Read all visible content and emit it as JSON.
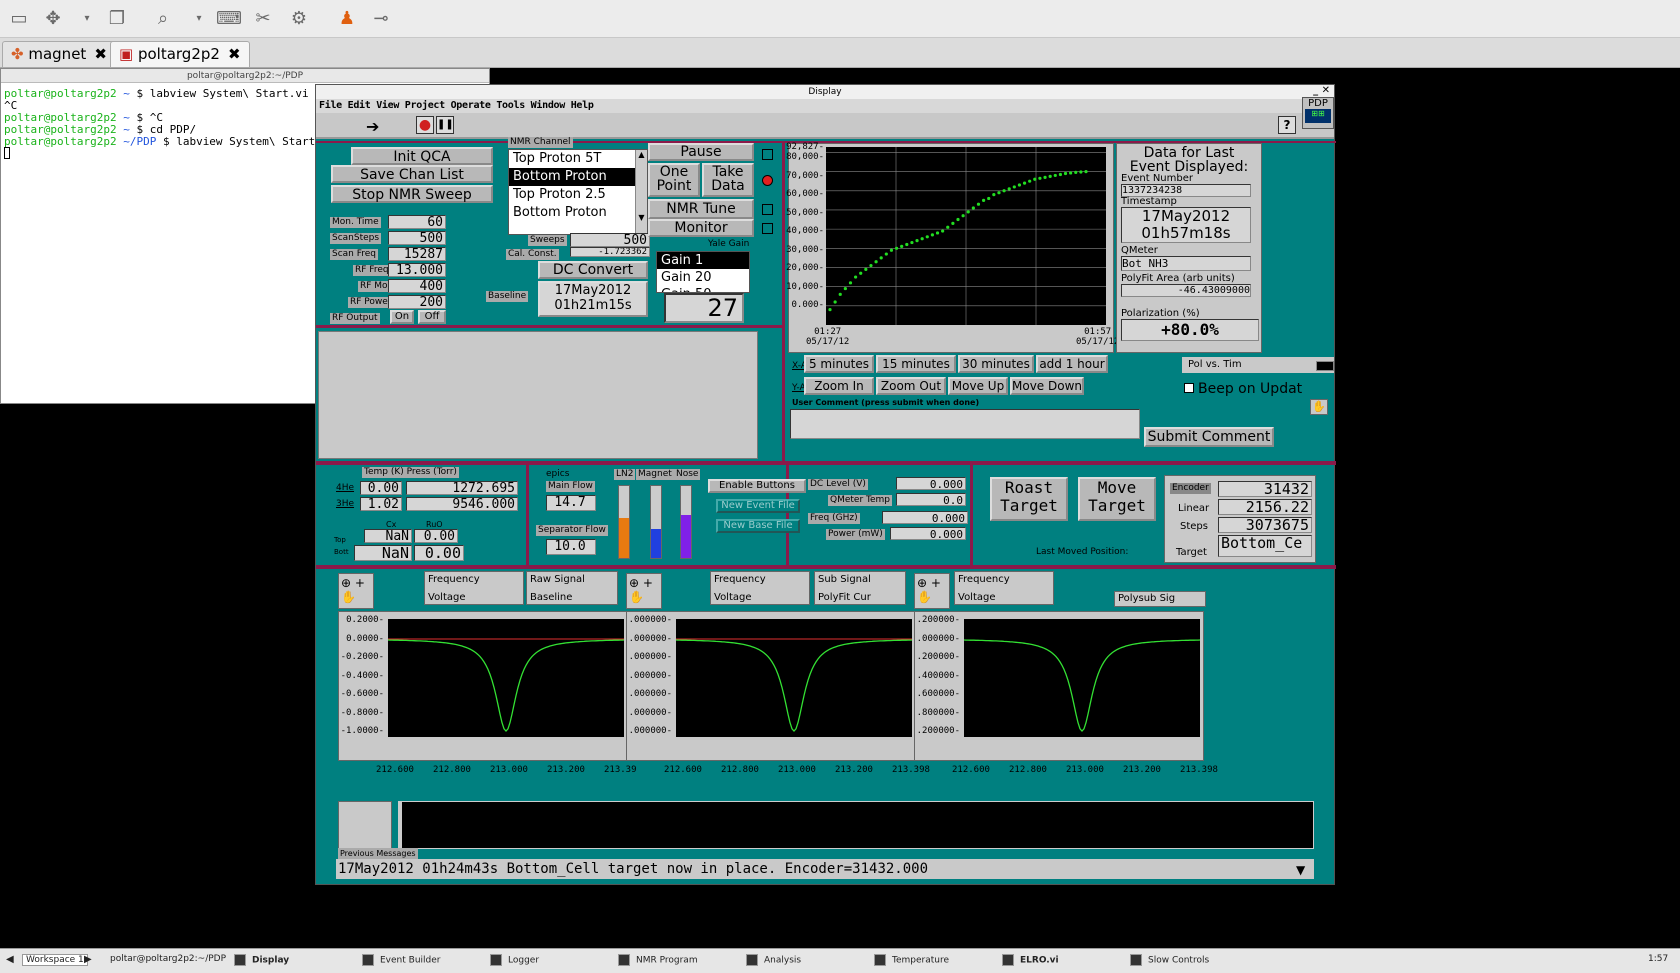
{
  "tabs": [
    {
      "label": "magnet",
      "active": false
    },
    {
      "label": "poltarg2p2",
      "active": true
    }
  ],
  "terminal": {
    "title": "poltar@poltarg2p2:~/PDP",
    "lines": [
      {
        "prompt": "poltar@poltarg2p2",
        "dir": " ~ ",
        "cmd": "$ labview System\\ Start.vi -- Co"
      },
      {
        "prompt": "",
        "dir": "",
        "cmd": "^C"
      },
      {
        "prompt": "poltar@poltarg2p2",
        "dir": " ~ ",
        "cmd": "$ ^C"
      },
      {
        "prompt": "poltar@poltarg2p2",
        "dir": " ~ ",
        "cmd": "$ cd PDP/"
      },
      {
        "prompt": "poltar@poltarg2p2",
        "dir": " ~/PDP ",
        "cmd": "$ labview System\\ Start.vi -"
      }
    ]
  },
  "display": {
    "title": "Display",
    "menu": "File Edit View Project Operate Tools Window Help",
    "pdp_label": "PDP",
    "nmr": {
      "init_qca": "Init QCA",
      "save_chan_list": "Save Chan List",
      "stop_nmr_sweep": "Stop NMR Sweep",
      "fields": [
        {
          "label": "Mon. Time",
          "value": "60"
        },
        {
          "label": "ScanSteps",
          "value": "500"
        },
        {
          "label": "Scan Freq",
          "value": "15287"
        },
        {
          "label": "RF Freq",
          "value": "13.000"
        },
        {
          "label": "RF Mod",
          "value": "400"
        },
        {
          "label": "RF Power",
          "value": "200"
        }
      ],
      "rf_output_label": "RF Output",
      "rf_on": "On",
      "rf_off": "Off",
      "channel_label": "NMR Channel",
      "channels": [
        "Top Proton 5T",
        "Bottom Proton",
        "Top Proton 2.5",
        "Bottom Proton"
      ],
      "selected_channel": 1,
      "sweeps_label": "Sweeps",
      "sweeps_value": "500",
      "cal_const_label": "Cal. Const.",
      "cal_const_value": "-1.723362",
      "dc_convert": "DC Convert",
      "baseline_label": "Baseline",
      "baseline_date": "17May2012",
      "baseline_time": "01h21m15s",
      "pause": "Pause",
      "one_point": [
        "One",
        "Point"
      ],
      "take_data": [
        "Take",
        "Data"
      ],
      "nmr_tune": "NMR Tune",
      "monitor": "Monitor",
      "yale_gain_label": "Yale Gain",
      "gains": [
        "Gain 1",
        "Gain 20",
        "Gain 50"
      ],
      "gain_count": "27"
    },
    "pol_chart": {
      "y_ticks": [
        "92,827-",
        "80,000-",
        "70,000-",
        "60,000-",
        "50,000-",
        "40,000-",
        "30,000-",
        "20,000-",
        "10,000-",
        "0.000-"
      ],
      "x_start": [
        "01:27",
        "05/17/12"
      ],
      "x_end": [
        "01:57",
        "05/17/12"
      ]
    },
    "chart_data": {
      "type": "line",
      "title": "",
      "xlabel": "",
      "ylabel": "",
      "ylim": [
        0,
        92.827
      ],
      "x_range": [
        "01:27 05/17/12",
        "01:57 05/17/12"
      ],
      "series": [
        {
          "color": "#22dd22",
          "values": [
            8,
            12,
            16,
            19,
            22,
            25,
            27,
            29,
            31,
            33,
            35,
            37,
            39,
            40,
            41,
            42,
            43,
            44,
            45,
            46,
            47,
            48,
            49,
            51,
            53,
            55,
            57,
            59,
            61,
            63,
            65,
            66,
            68,
            69,
            70,
            71,
            72,
            73,
            74,
            75,
            76,
            76.5,
            77,
            77.5,
            78,
            78.5,
            79,
            79.3,
            79.6,
            79.8,
            80
          ]
        }
      ]
    },
    "event_info": {
      "header1": "Data for Last",
      "header2": "Event Displayed:",
      "event_number_label": "Event Number",
      "event_number": "1337234238",
      "timestamp_label": "Timestamp",
      "ts_date": "17May2012",
      "ts_time": "01h57m18s",
      "qmeter_label": "QMeter",
      "qmeter_value": "Bot NH3",
      "polyfit_label": "PolyFit Area (arb units)",
      "polyfit_value": "-46.43009000",
      "polarization_label": "Polarization (%)",
      "polarization_value": "+80.0%"
    },
    "axis_controls": {
      "x_label": "X-Axis",
      "x_buttons": [
        "5 minutes",
        "15 minutes",
        "30 minutes",
        "add 1 hour"
      ],
      "y_label": "Y-Axis",
      "y_buttons": [
        "Zoom In",
        "Zoom Out",
        "Move Up",
        "Move Down"
      ],
      "beep_label": "Beep on Updat",
      "pol_vs_time": "Pol vs. Tim"
    },
    "comment": {
      "label": "User Comment (press submit when done)",
      "submit": "Submit Comment"
    },
    "temps": {
      "label": "Temp (K) Press (Torr)",
      "he4_label": "4He",
      "he4_temp": "0.00",
      "he4_press": "1272.695",
      "he3_label": "3He",
      "he3_temp": "1.02",
      "he3_press": "9546.000",
      "cx_label": "Cx",
      "ruo_label": "RuO",
      "top_label": "Top",
      "top_cx": "NaN",
      "top_ruo": "0.00",
      "bott_label": "Bott",
      "bott_cx": "NaN",
      "bott_ruo": "0.00"
    },
    "epics": {
      "label": "epics",
      "main_flow_label": "Main Flow",
      "main_flow": "14.7",
      "sep_flow_label": "Separator Flow",
      "sep_flow": "10.0",
      "ln2_label": "LN2",
      "magnet_label": "Magnet",
      "nose_label": "Nose",
      "ln2_level": 0.55,
      "magnet_level": 0.4,
      "nose_level": 0.6
    },
    "buttons": {
      "enable": "Enable Buttons",
      "new_event": "New Event File",
      "new_base": "New Base File"
    },
    "dc": {
      "dc_level_label": "DC Level (V)",
      "dc_level": "0.000",
      "qmeter_temp_label": "QMeter Temp",
      "qmeter_temp": "0.0",
      "freq_label": "Freq (GHz)",
      "freq": "0.000",
      "power_label": "Power (mW)",
      "power": "0.000"
    },
    "target": {
      "roast": [
        "Roast",
        "Target"
      ],
      "move": [
        "Move",
        "Target"
      ],
      "last_moved": "Last Moved Position:",
      "encoder_label": "Encoder",
      "encoder": "31432",
      "linear_label": "Linear",
      "linear": "2156.22",
      "steps_label": "Steps",
      "steps": "3073675",
      "target_label": "Target",
      "target_value": "Bottom_Ce"
    },
    "signal_plots": [
      {
        "legend1": "Raw Signal",
        "legend2": "Baseline",
        "y_ticks": [
          "0.2000-",
          "0.0000-",
          "-0.2000-",
          "-0.4000-",
          "-0.6000-",
          "-0.8000-",
          "-1.0000-"
        ]
      },
      {
        "legend1": "Sub Signal",
        "legend2": "PolyFit Cur",
        "y_ticks": [
          ".000000-",
          ".000000-",
          ".000000-",
          ".000000-",
          ".000000-",
          ".000000-",
          ".000000-"
        ]
      },
      {
        "legend1": "Polysub Sig",
        "legend2": "",
        "y_ticks": [
          ".200000-",
          ".000000-",
          ".200000-",
          ".400000-",
          ".600000-",
          ".800000-",
          ".200000-"
        ]
      }
    ],
    "freq_label": "Frequency",
    "volt_label": "Voltage",
    "x_ticks": [
      "212.600",
      "212.800",
      "213.000",
      "213.200",
      "213.398"
    ],
    "x_ticks_first": [
      "212.600",
      "212.800",
      "213.000",
      "213.200",
      "213.39"
    ],
    "prev_msgs_label": "Previous Messages",
    "status_msg": "17May2012 01h24m43s Bottom_Cell target now in place.  Encoder=31432.000"
  },
  "taskbar": {
    "workspace": "Workspace 1",
    "items": [
      "poltar@poltarg2p2:~/PDP",
      "Display",
      "Event Builder",
      "Logger",
      "NMR Program",
      "Analysis",
      "Temperature",
      "ELRO.vi",
      "Slow Controls"
    ],
    "clock": "1:57"
  }
}
